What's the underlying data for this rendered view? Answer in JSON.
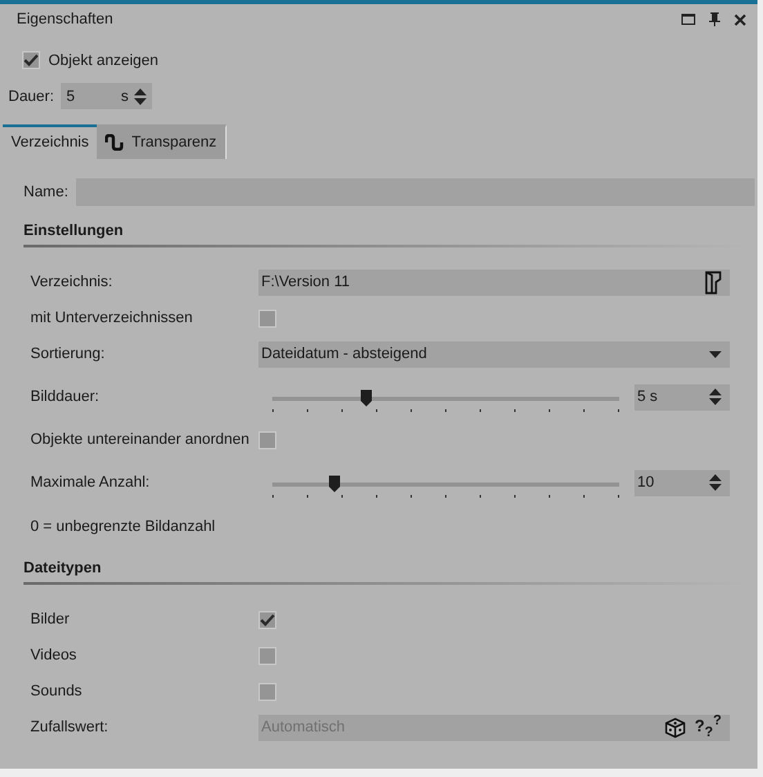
{
  "panel": {
    "title": "Eigenschaften"
  },
  "show_object": {
    "label": "Objekt anzeigen",
    "checked": true
  },
  "duration": {
    "label": "Dauer:",
    "value": "5",
    "unit": "s"
  },
  "tabs": [
    {
      "label": "Verzeichnis",
      "selected": true
    },
    {
      "label": "Transparenz",
      "selected": false
    }
  ],
  "name": {
    "label": "Name:"
  },
  "sections": [
    {
      "title": "Einstellungen",
      "rows": [
        {
          "kind": "path",
          "label": "Verzeichnis:",
          "value": "F:\\Version 11"
        },
        {
          "kind": "checkbox",
          "label": "mit Unterverzeichnissen",
          "checked": false
        },
        {
          "kind": "dropdown",
          "label": "Sortierung:",
          "value": "Dateidatum - absteigend"
        },
        {
          "kind": "slider",
          "label": "Bilddauer:",
          "level": 0.27,
          "value": "5 s"
        },
        {
          "kind": "checkbox",
          "label": "Objekte untereinander anordnen",
          "checked": false
        },
        {
          "kind": "slider",
          "label": "Maximale Anzahl:",
          "level": 0.18,
          "value": "10"
        },
        {
          "kind": "note",
          "label": "0 = unbegrenzte Bildanzahl"
        }
      ]
    },
    {
      "title": "Dateitypen",
      "rows": [
        {
          "kind": "checkbox",
          "label": "Bilder",
          "checked": true
        },
        {
          "kind": "checkbox",
          "label": "Videos",
          "checked": false
        },
        {
          "kind": "checkbox",
          "label": "Sounds",
          "checked": false
        },
        {
          "kind": "random",
          "label": "Zufallswert:",
          "placeholder": "Automatisch",
          "help": "?$_{?}$$^{?}$"
        }
      ]
    }
  ]
}
